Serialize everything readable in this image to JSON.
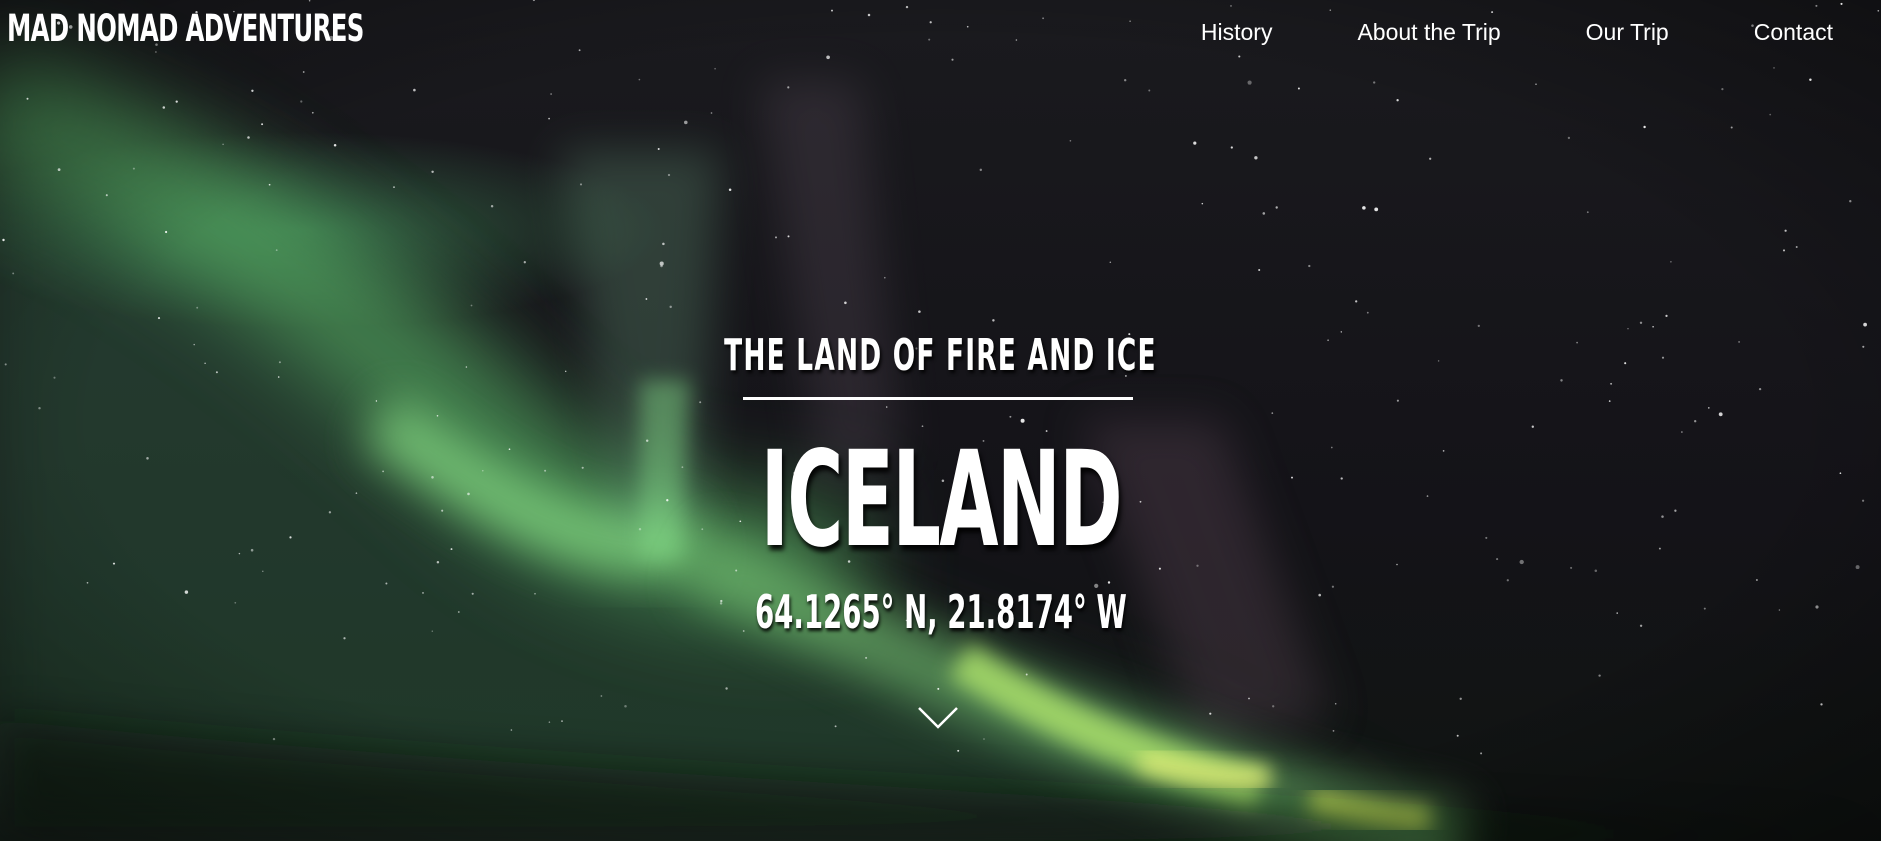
{
  "brand": {
    "name": "MAD NOMAD ADVENTURES"
  },
  "nav": {
    "items": [
      {
        "label": "History"
      },
      {
        "label": "About the Trip"
      },
      {
        "label": "Our Trip"
      },
      {
        "label": "Contact"
      }
    ]
  },
  "hero": {
    "tagline": "THE LAND OF FIRE AND ICE",
    "title": "ICELAND",
    "coordinates": "64.1265° N, 21.8174° W",
    "scroll_icon": "chevron-down-icon",
    "background": "northern-lights-night-sky-photo"
  },
  "colors": {
    "text": "#ffffff",
    "aurora_green": "#7de07a",
    "aurora_yellow": "#d8f060",
    "sky": "#15141a"
  }
}
